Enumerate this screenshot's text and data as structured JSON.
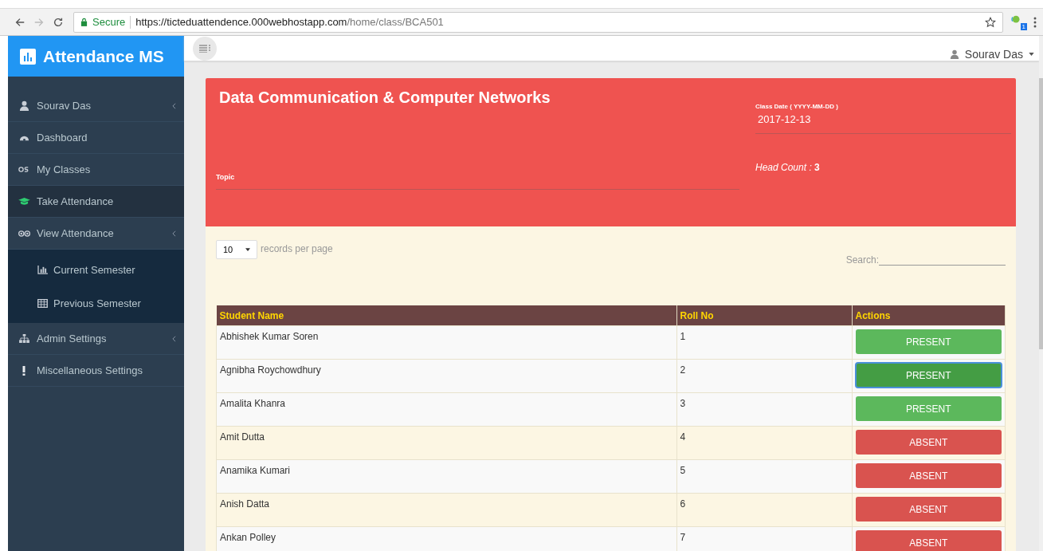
{
  "browser": {
    "security": "Secure",
    "url_host": "https://ticteduattendence.000webhostapp.com",
    "url_path": "/home/class/BCA501",
    "extension_badge": "1"
  },
  "app": {
    "brand": "Attendance MS",
    "user": "Sourav Das"
  },
  "sidebar": {
    "items": [
      {
        "label": "Sourav Das",
        "selected": false,
        "expandable": true
      },
      {
        "label": "Dashboard",
        "selected": false,
        "expandable": false
      },
      {
        "label": "My Classes",
        "selected": false,
        "expandable": false
      },
      {
        "label": "Take Attendance",
        "selected": true,
        "expandable": false
      },
      {
        "label": "View Attendance",
        "selected": false,
        "expandable": true,
        "expanded": true,
        "children": [
          {
            "label": "Current Semester"
          },
          {
            "label": "Previous Semester"
          }
        ]
      },
      {
        "label": "Admin Settings",
        "selected": false,
        "expandable": true
      },
      {
        "label": "Miscellaneous Settings",
        "selected": false,
        "expandable": false
      }
    ]
  },
  "class_card": {
    "title": "Data Communication & Computer Networks",
    "topic_label": "Topic",
    "date_label": "Class Date ( YYYY-MM-DD )",
    "date": "2017-12-13",
    "head_count_label": "Head Count :",
    "head_count": "3"
  },
  "table_controls": {
    "page_size": "10",
    "page_size_label": "records per page",
    "search_label": "Search:"
  },
  "table": {
    "columns": [
      "Student Name",
      "Roll No",
      "Actions"
    ],
    "rows": [
      {
        "name": "Abhishek Kumar Soren",
        "roll": "1",
        "action": {
          "kind": "present",
          "label": "PRESENT",
          "selected": false
        }
      },
      {
        "name": "Agnibha Roychowdhury",
        "roll": "2",
        "action": {
          "kind": "present",
          "label": "PRESENT",
          "selected": true
        }
      },
      {
        "name": "Amalita Khanra",
        "roll": "3",
        "action": {
          "kind": "present",
          "label": "PRESENT",
          "selected": false
        }
      },
      {
        "name": "Amit Dutta",
        "roll": "4",
        "action": {
          "kind": "absent",
          "label": "ABSENT",
          "selected": false
        }
      },
      {
        "name": "Anamika Kumari",
        "roll": "5",
        "action": {
          "kind": "absent",
          "label": "ABSENT",
          "selected": false
        }
      },
      {
        "name": "Anish Datta",
        "roll": "6",
        "action": {
          "kind": "absent",
          "label": "ABSENT",
          "selected": false
        }
      },
      {
        "name": "Ankan Polley",
        "roll": "7",
        "action": {
          "kind": "absent",
          "label": "ABSENT",
          "selected": false
        }
      }
    ]
  }
}
